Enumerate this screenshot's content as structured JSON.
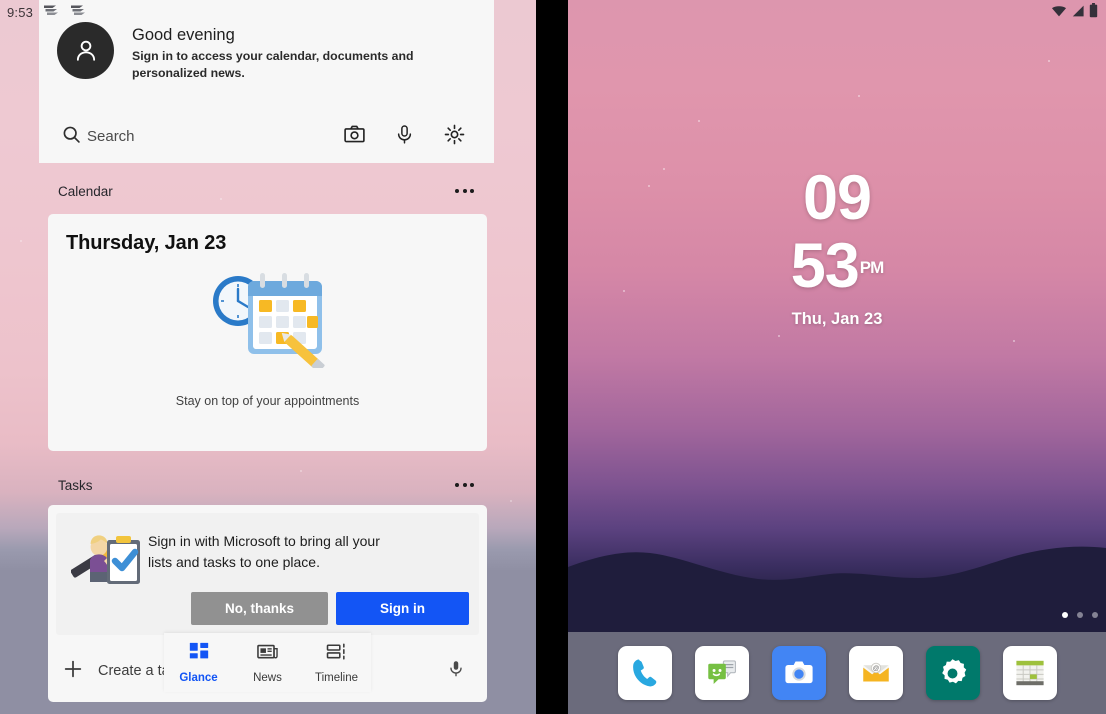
{
  "left_panel": {
    "status_bar": {
      "time": "9:53",
      "notification_icons": [
        "launcher-swoosh-icon",
        "launcher-swoosh-icon"
      ]
    },
    "header_card": {
      "avatar_icon": "person-avatar-icon",
      "greeting_title": "Good evening",
      "greeting_subtitle": "Sign in to access your calendar, documents and personalized news.",
      "search": {
        "icon": "search-icon",
        "placeholder": "Search",
        "actions": [
          "camera-icon",
          "microphone-icon",
          "gear-icon"
        ]
      }
    },
    "calendar_section": {
      "title": "Calendar",
      "overflow_icon": "more-options-icon",
      "card": {
        "date": "Thursday, Jan 23",
        "illustration": "calendar-clock-pencil-illustration",
        "caption": "Stay on top of your appointments"
      }
    },
    "tasks_section": {
      "title": "Tasks",
      "overflow_icon": "more-options-icon",
      "card": {
        "illustration": "person-clipboard-checkmark-illustration",
        "message": "Sign in with Microsoft to bring all your lists and tasks to one place.",
        "decline_label": "No, thanks",
        "signin_label": "Sign in",
        "decline_color": "#919191",
        "signin_color": "#1355f5",
        "create_task_label": "Create a task",
        "add_icon": "plus-icon",
        "voice_icon": "microphone-icon"
      }
    },
    "tab_bar": {
      "active_color": "#1355f5",
      "tabs": [
        {
          "label": "Glance",
          "icon": "grid-squares-icon",
          "active": true
        },
        {
          "label": "News",
          "icon": "newspaper-icon",
          "active": false
        },
        {
          "label": "Timeline",
          "icon": "timeline-icon",
          "active": false
        }
      ]
    }
  },
  "right_panel": {
    "status_bar": {
      "icons": [
        "wifi-icon",
        "cell-signal-icon",
        "battery-icon"
      ]
    },
    "clock_widget": {
      "hours": "09",
      "minutes": "53",
      "meridiem": "PM",
      "date": "Thu, Jan 23"
    },
    "page_indicator": {
      "total": 3,
      "active_index": 0
    },
    "dock": {
      "background": "#6b6b7c",
      "apps": [
        {
          "name": "Phone",
          "icon": "phone-icon",
          "bg": "#ffffff",
          "fg": "#29a8e0"
        },
        {
          "name": "Messaging",
          "icon": "messaging-icon",
          "bg": "#ffffff",
          "fg": "#76c043"
        },
        {
          "name": "Camera",
          "icon": "camera-icon",
          "bg": "#4285f4",
          "fg": "#ffffff"
        },
        {
          "name": "Email",
          "icon": "email-icon",
          "bg": "#ffffff",
          "fg": "#f5b421"
        },
        {
          "name": "Settings",
          "icon": "settings-gear-icon",
          "bg": "#00796b",
          "fg": "#ffffff"
        },
        {
          "name": "Calculator",
          "icon": "spreadsheet-icon",
          "bg": "#ffffff",
          "fg": "#9ec13c"
        }
      ]
    }
  }
}
